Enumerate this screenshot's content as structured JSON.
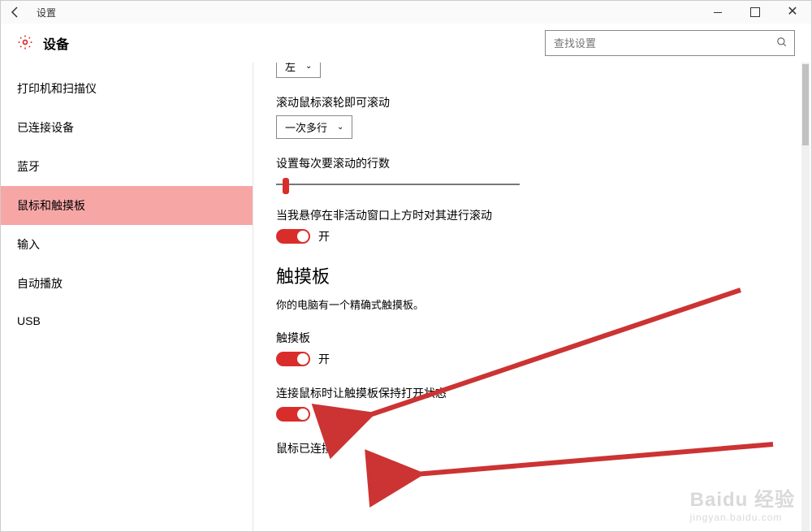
{
  "window": {
    "title": "设置"
  },
  "page": {
    "heading": "设备"
  },
  "search": {
    "placeholder": "查找设置"
  },
  "sidebar": {
    "items": [
      {
        "label": "打印机和扫描仪"
      },
      {
        "label": "已连接设备"
      },
      {
        "label": "蓝牙"
      },
      {
        "label": "鼠标和触摸板"
      },
      {
        "label": "输入"
      },
      {
        "label": "自动播放"
      },
      {
        "label": "USB"
      }
    ]
  },
  "main": {
    "primary_button_dropdown": {
      "value": "左"
    },
    "scroll_wheel": {
      "label": "滚动鼠标滚轮即可滚动",
      "value": "一次多行"
    },
    "lines_per_scroll": {
      "label": "设置每次要滚动的行数"
    },
    "inactive_hover": {
      "label": "当我悬停在非活动窗口上方时对其进行滚动",
      "state": "开"
    },
    "touchpad": {
      "title": "触摸板",
      "desc": "你的电脑有一个精确式触摸板。",
      "enable_label": "触摸板",
      "enable_state": "开",
      "keep_on_label": "连接鼠标时让触摸板保持打开状态",
      "keep_on_state": "开",
      "mouse_connected": "鼠标已连接"
    }
  },
  "colors": {
    "accent": "#d92d2c"
  },
  "watermark": {
    "brand": "Baidu 经验",
    "url": "jingyan.baidu.com"
  }
}
